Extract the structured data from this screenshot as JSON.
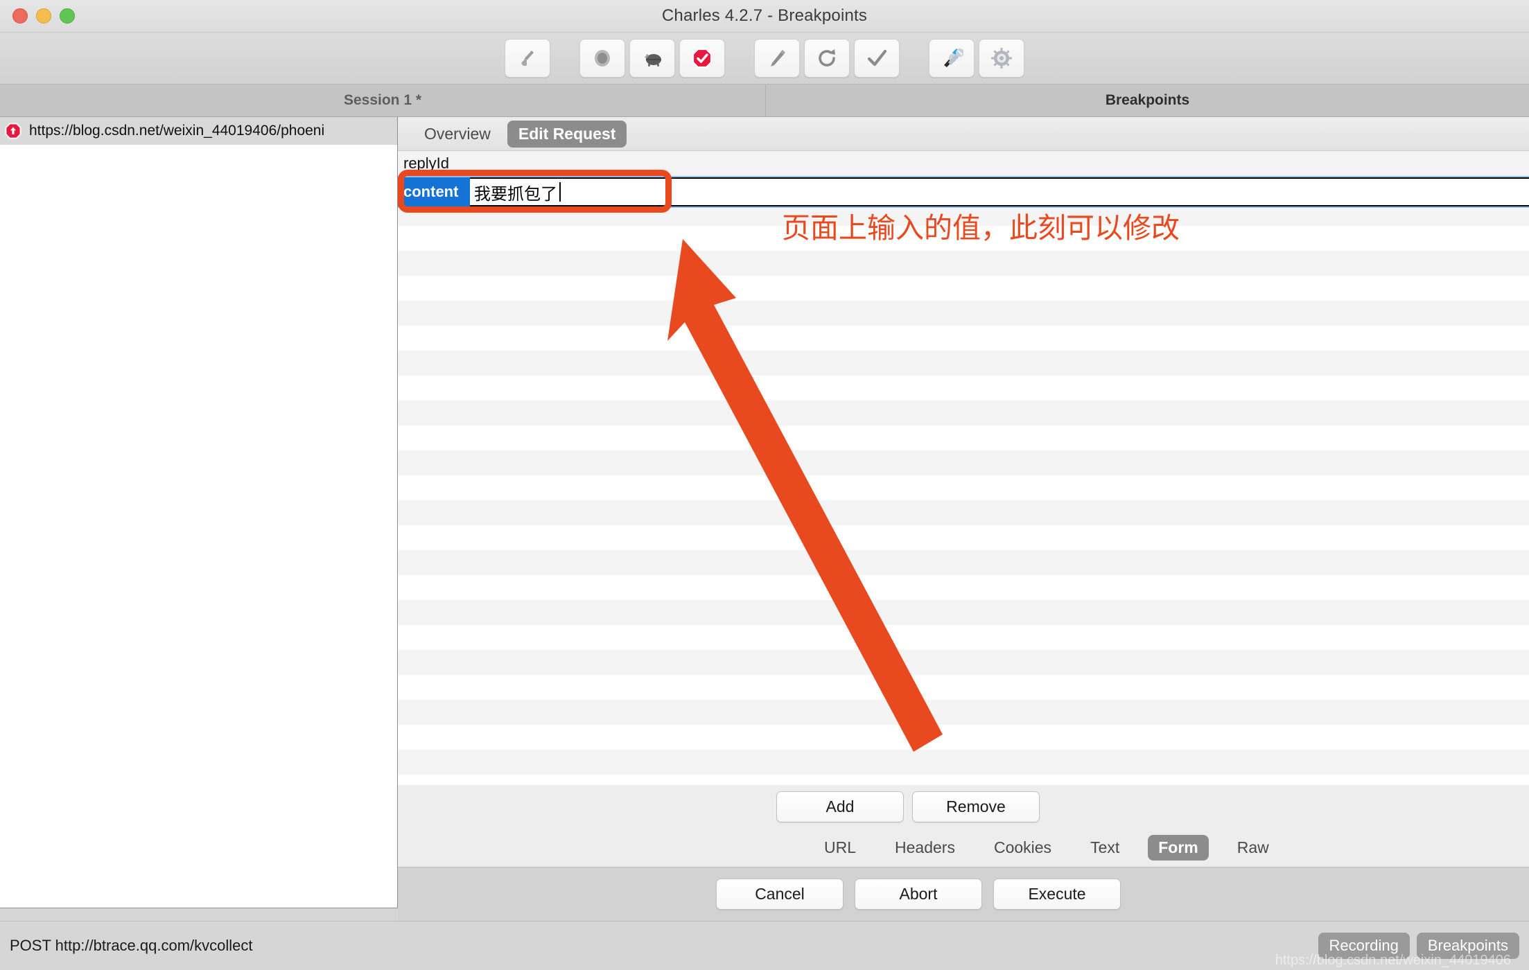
{
  "window": {
    "title": "Charles 4.2.7 - Breakpoints",
    "traffic_lights": [
      "close",
      "minimize",
      "maximize"
    ]
  },
  "toolbar": {
    "buttons": [
      {
        "name": "clear-icon",
        "glyph": "broom"
      },
      {
        "name": "record-icon",
        "glyph": "record"
      },
      {
        "name": "throttle-icon",
        "glyph": "turtle"
      },
      {
        "name": "breakpoints-icon",
        "glyph": "octagon-check"
      },
      {
        "name": "compose-icon",
        "glyph": "pen"
      },
      {
        "name": "repeat-icon",
        "glyph": "refresh"
      },
      {
        "name": "validate-icon",
        "glyph": "check"
      },
      {
        "name": "tools-icon",
        "glyph": "wrench-screwdriver"
      },
      {
        "name": "settings-icon",
        "glyph": "gear"
      }
    ]
  },
  "panes": {
    "session_header": "Session 1 *",
    "breakpoints_header": "Breakpoints"
  },
  "session_list": {
    "rows": [
      {
        "icon": "breakpoint-octagon-icon",
        "label": "https://blog.csdn.net/weixin_44019406/phoeni"
      }
    ]
  },
  "breakpoint_tabs": [
    {
      "label": "Overview",
      "active": false
    },
    {
      "label": "Edit Request",
      "active": true
    }
  ],
  "form": {
    "fields": [
      {
        "key": "replyId",
        "value": "",
        "selected": false
      },
      {
        "key": "content",
        "value": "我要抓包了",
        "selected": true
      }
    ]
  },
  "form_buttons": {
    "add": "Add",
    "remove": "Remove"
  },
  "payload_tabs": [
    {
      "label": "URL",
      "active": false
    },
    {
      "label": "Headers",
      "active": false
    },
    {
      "label": "Cookies",
      "active": false
    },
    {
      "label": "Text",
      "active": false
    },
    {
      "label": "Form",
      "active": true
    },
    {
      "label": "Raw",
      "active": false
    }
  ],
  "action_buttons": {
    "cancel": "Cancel",
    "abort": "Abort",
    "execute": "Execute"
  },
  "statusbar": {
    "text": "POST http://btrace.qq.com/kvcollect",
    "badges": [
      "Recording",
      "Breakpoints"
    ],
    "watermark": "https://blog.csdn.net/weixin_44019406"
  },
  "annotation": {
    "text": "页面上输入的值，此刻可以修改",
    "color": "#e8491f"
  }
}
